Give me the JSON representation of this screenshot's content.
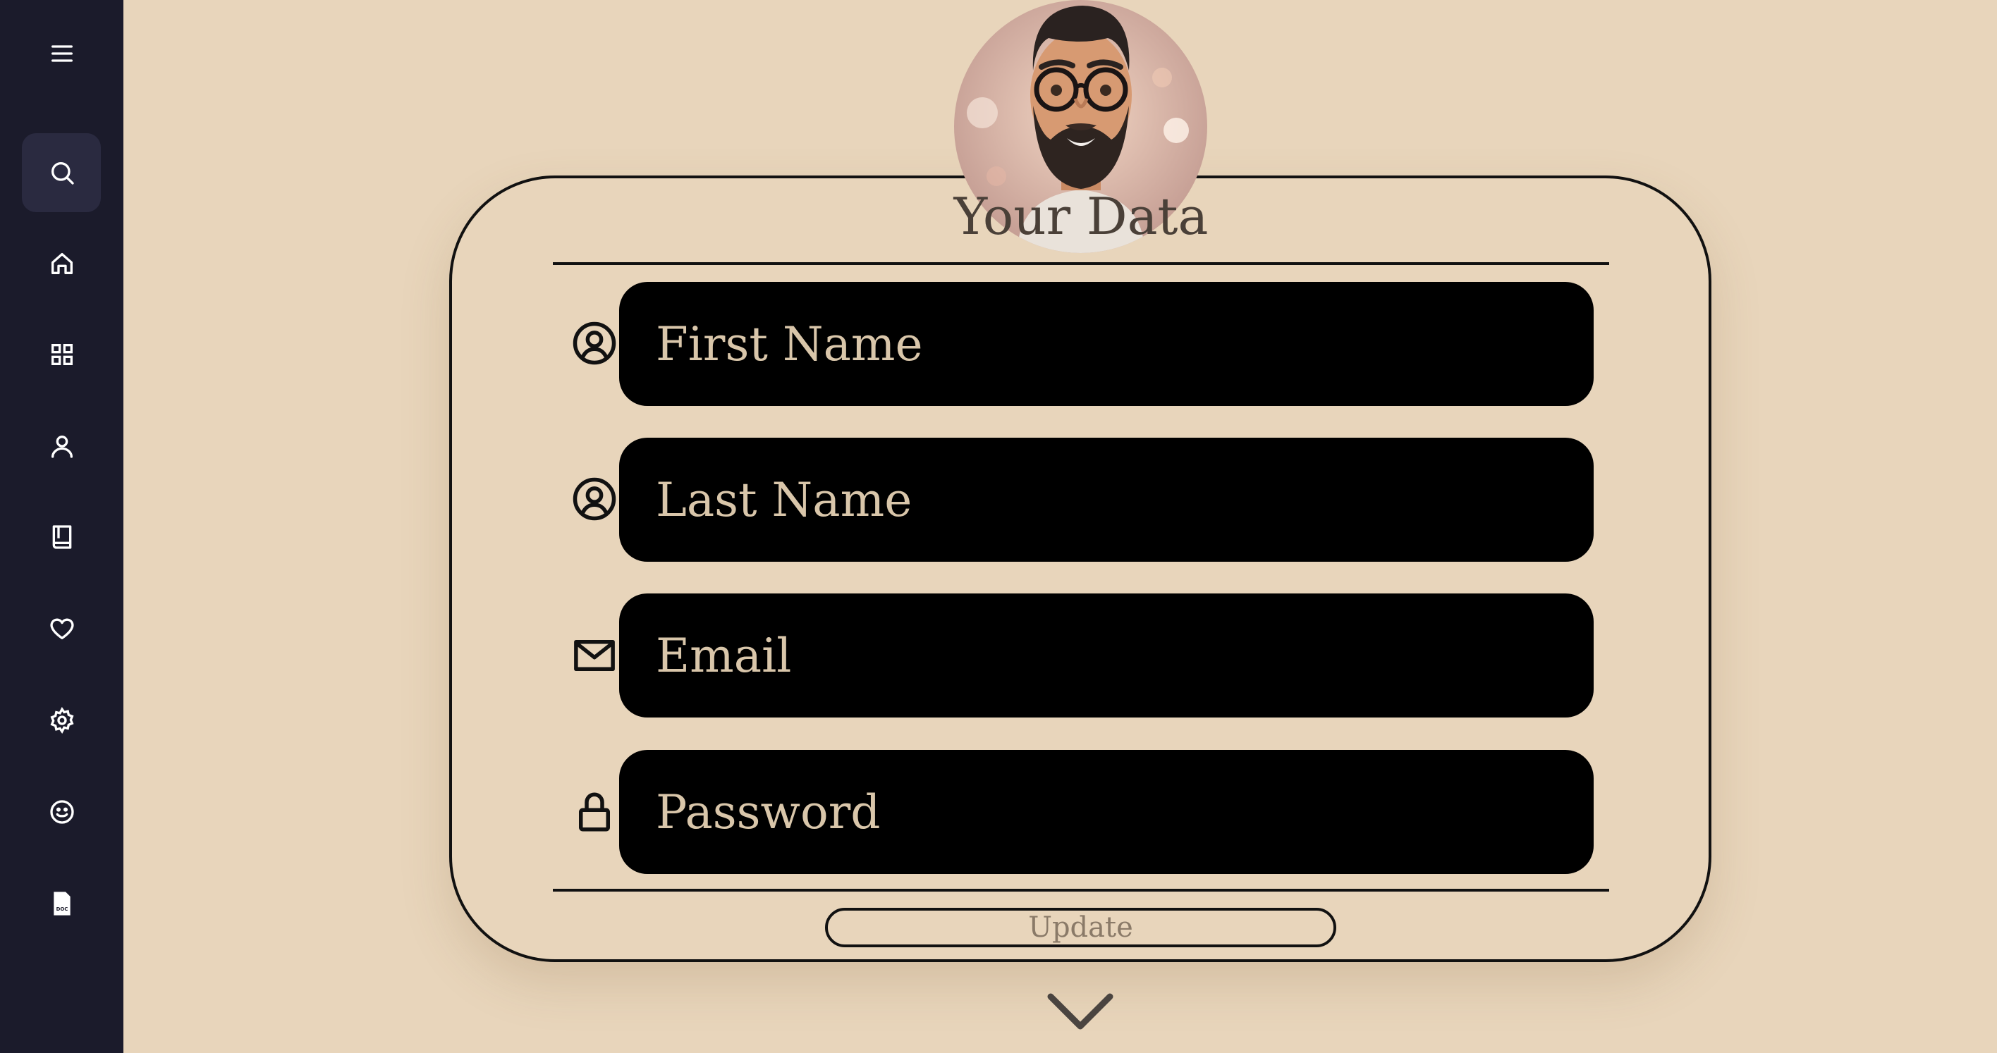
{
  "sidebar": {
    "items": [
      {
        "icon": "menu-icon"
      },
      {
        "icon": "search-icon",
        "active": true
      },
      {
        "icon": "home-icon"
      },
      {
        "icon": "grid-icon"
      },
      {
        "icon": "user-icon"
      },
      {
        "icon": "book-icon"
      },
      {
        "icon": "heart-icon"
      },
      {
        "icon": "gear-icon"
      },
      {
        "icon": "smile-icon"
      },
      {
        "icon": "doc-file-icon",
        "badge": "DOC"
      }
    ],
    "colors": {
      "background": "#1b1b2b",
      "active": "#2a2a40",
      "icon": "#ffffff"
    }
  },
  "profile": {
    "title": "Your Data",
    "fields": [
      {
        "icon": "user-circle-icon",
        "placeholder": "First Name",
        "value": ""
      },
      {
        "icon": "user-circle-icon",
        "placeholder": "Last Name",
        "value": ""
      },
      {
        "icon": "mail-icon",
        "placeholder": "Email",
        "value": ""
      },
      {
        "icon": "lock-icon",
        "placeholder": "Password",
        "value": ""
      }
    ],
    "update_label": "Update"
  },
  "colors": {
    "page_background": "#e8d5bb",
    "field_background": "#000000",
    "field_text": "#e8d5bb"
  }
}
